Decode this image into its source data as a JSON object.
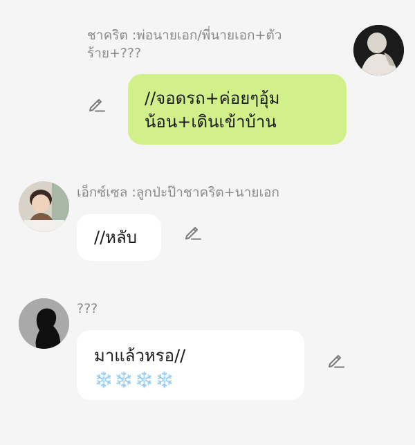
{
  "messages": [
    {
      "side": "right",
      "name": "ชาคริต :พ่อนายเอก/พี่นายเอก+ตัวร้าย+???",
      "text": "//จอดรถ+ค่อยๆอุ้มน้อน+เดินเข้าบ้าน",
      "bubble_color": "#d2f08a",
      "avatar_icon": "person-photo-avatar-icon"
    },
    {
      "side": "left",
      "name": "เอ็กซ์เซล :ลูกป่ะป๊าชาคริต+นายเอก",
      "text": "//หลับ",
      "bubble_color": "#ffffff",
      "avatar_icon": "toddler-photo-avatar-icon"
    },
    {
      "side": "left",
      "name": "???",
      "text": "มาแล้วหรอ//",
      "emojis": "❄️❄️❄️❄️",
      "bubble_color": "#ffffff",
      "avatar_icon": "silhouette-avatar-icon"
    }
  ],
  "icons": {
    "edit": "pencil-edit-icon"
  },
  "colors": {
    "background": "#f5f5f5",
    "name_text": "#8a8a8a",
    "green_bubble": "#d2f08a"
  }
}
